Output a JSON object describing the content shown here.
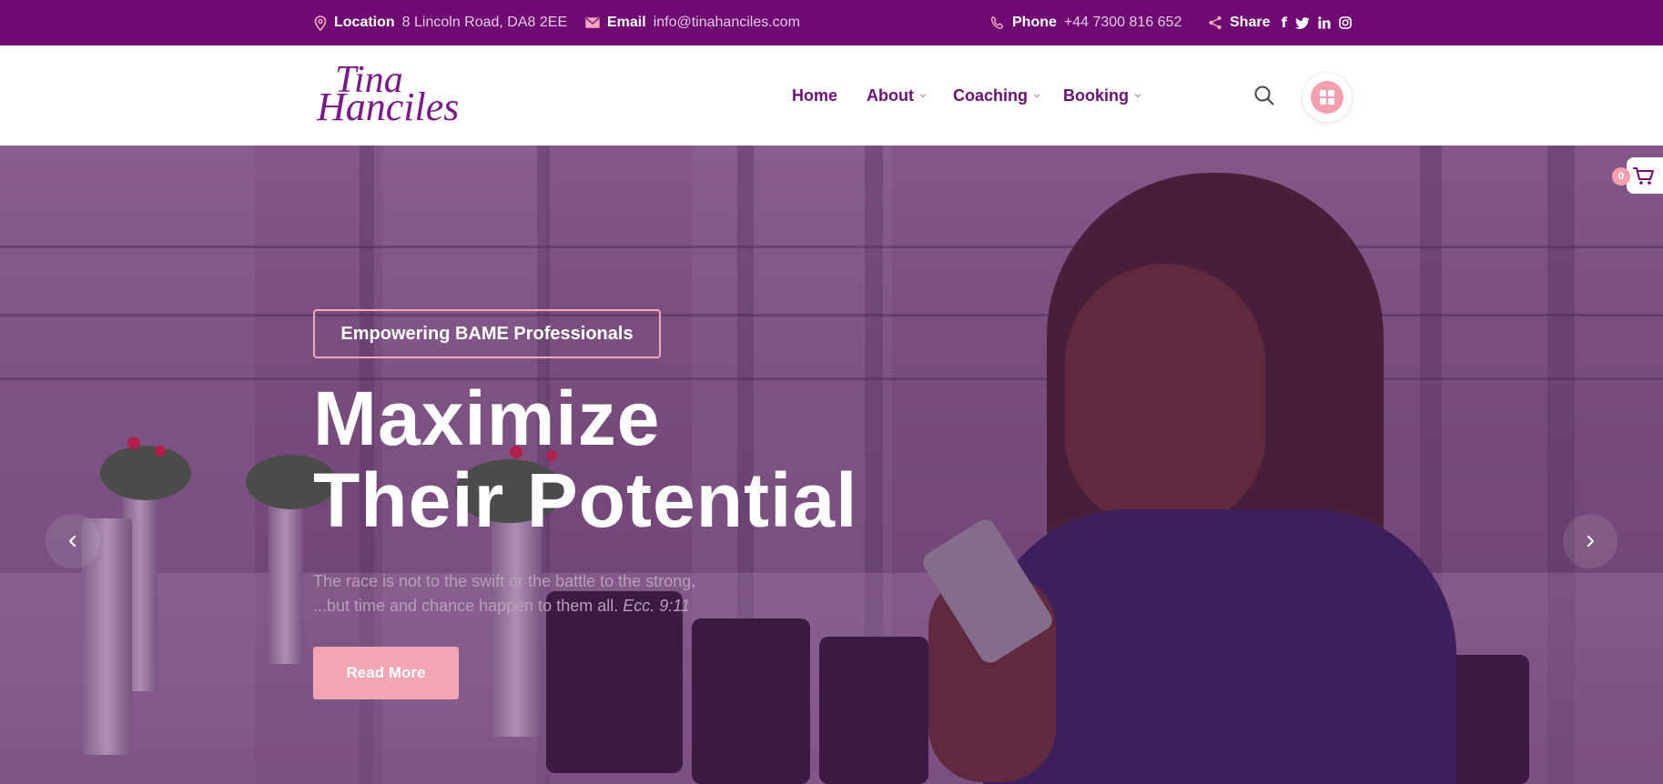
{
  "topbar": {
    "location_label": "Location",
    "location_value": "8 Lincoln Road, DA8 2EE",
    "email_label": "Email",
    "email_value": "info@tinahanciles.com",
    "phone_label": "Phone",
    "phone_value": "+44 7300 816 652",
    "share_label": "Share",
    "social_icons": [
      "facebook-icon",
      "twitter-icon",
      "linkedin-icon",
      "instagram-icon"
    ]
  },
  "header": {
    "logo_line1": "Tina",
    "logo_line2": "Hanciles",
    "nav": [
      {
        "label": "Home",
        "has_dropdown": false
      },
      {
        "label": "About",
        "has_dropdown": true
      },
      {
        "label": "Coaching",
        "has_dropdown": true
      },
      {
        "label": "Booking",
        "has_dropdown": true
      }
    ]
  },
  "hero": {
    "tag": "Empowering BAME Professionals",
    "title_line1": "Maximize",
    "title_line2": "Their Potential",
    "quote_line1": "The race is not to the swift or the battle to the strong,",
    "quote_line2": "...but time and chance happen to them all.",
    "quote_ref": "Ecc. 9:11",
    "cta_label": "Read More",
    "cart_count": "0"
  },
  "colors": {
    "brand_purple": "#6e0a72",
    "accent_pink": "#f2a5b4"
  }
}
